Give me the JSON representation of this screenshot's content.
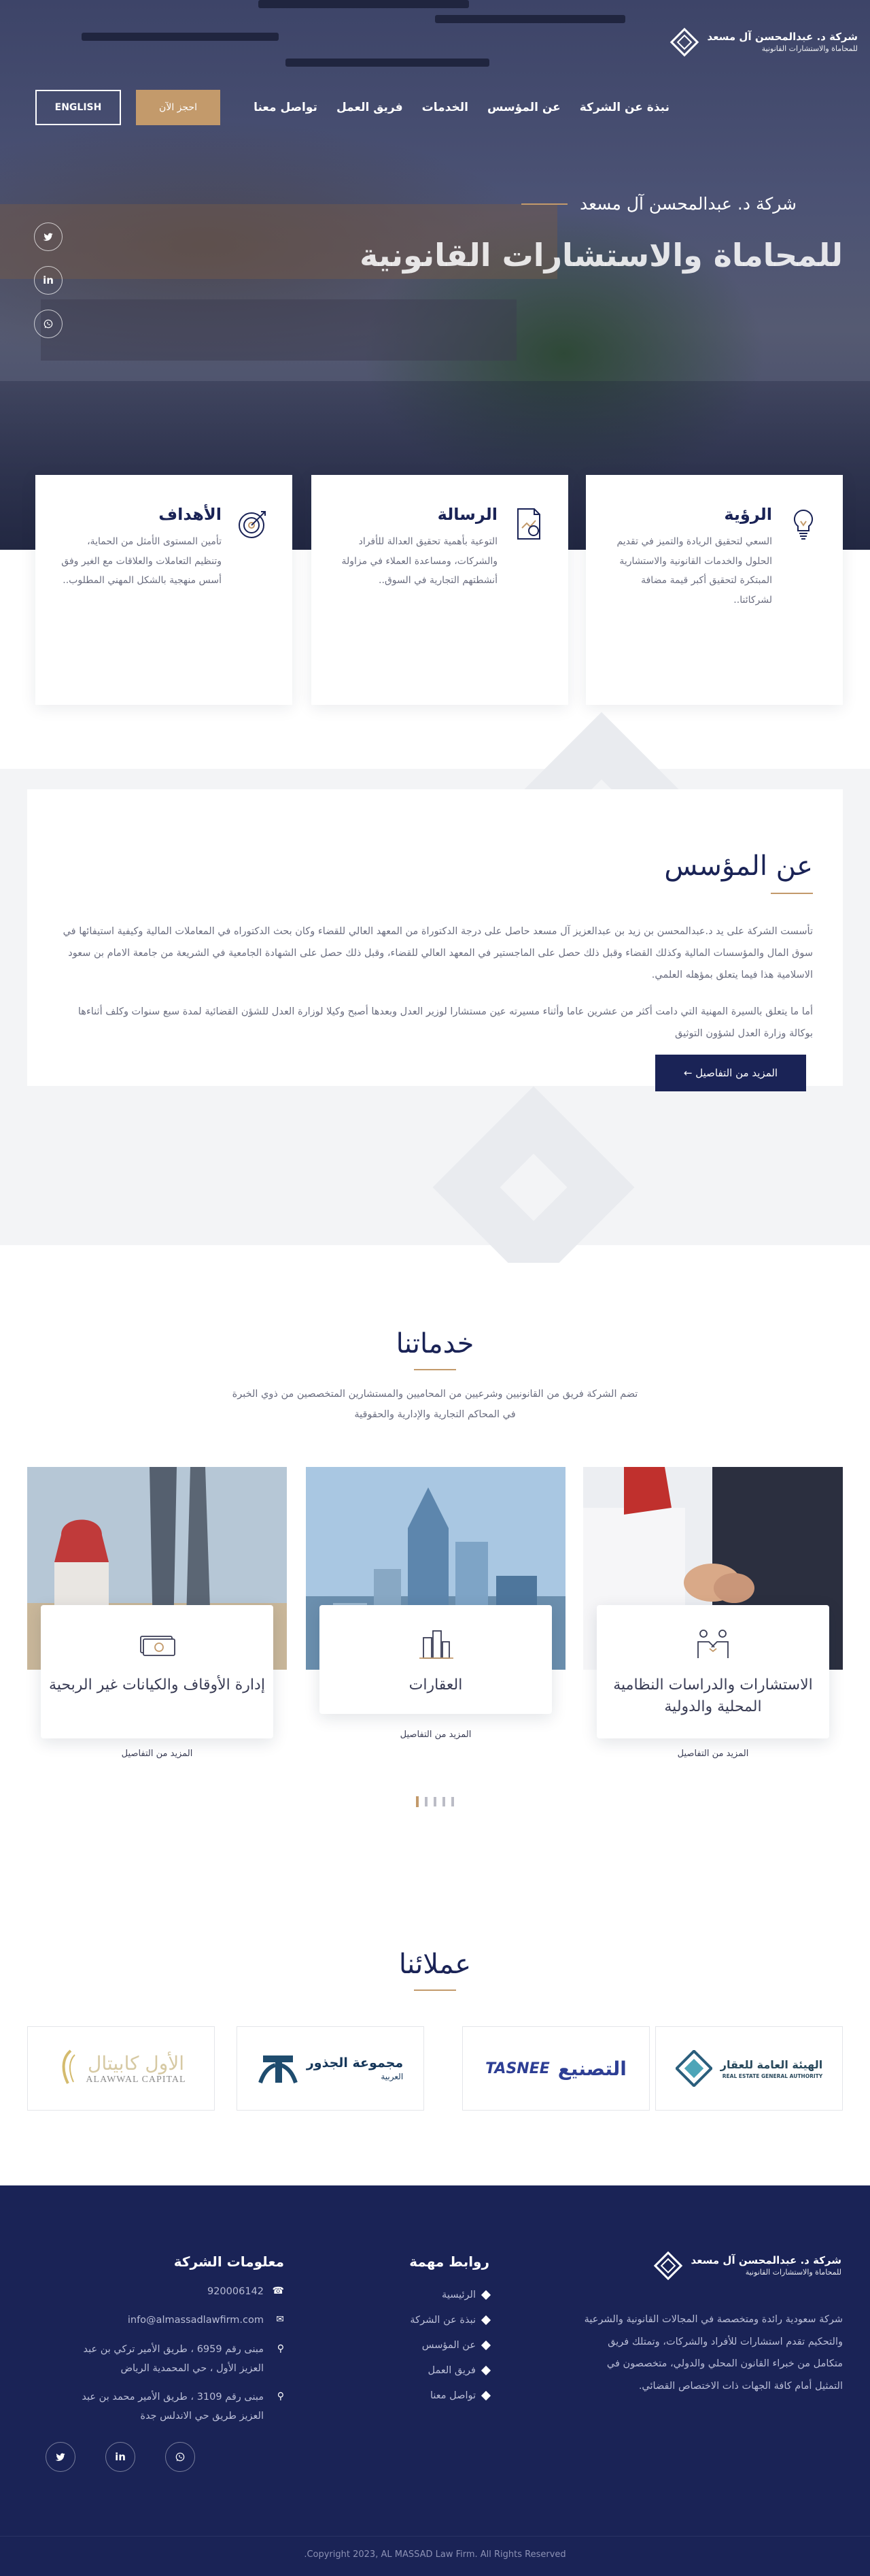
{
  "brand": {
    "name_line1": "شركة د. عبدالمحسن آل مسعد",
    "name_line2": "للمحاماة والاستشارات القانونية"
  },
  "nav": {
    "items": [
      "نبذة عن الشركة",
      "عن المؤسس",
      "الخدمات",
      "فريق العمل",
      "تواصل معنا"
    ],
    "book_label": "احجز الآن",
    "lang_label": "ENGLISH"
  },
  "hero": {
    "subtitle": "شركة د. عبدالمحسن آل مسعد",
    "title": "للمحاماة والاستشارات القانونية",
    "social": [
      "twitter-icon",
      "linkedin-icon",
      "whatsapp-icon"
    ]
  },
  "features": [
    {
      "title": "الرؤية",
      "text": "السعي لتحقيق الريادة والتميز في تقديم الحلول والخدمات القانونية والاستشارية المبتكرة لتحقيق أكبر قيمة مضافة لشركائنا..",
      "icon": "lightbulb-icon"
    },
    {
      "title": "الرسالة",
      "text": "التوعية بأهمية تحقيق العدالة للأفراد والشركات، ومساعدة العملاء في مزاولة أنشطتهم التجارية في السوق..",
      "icon": "document-chart-icon"
    },
    {
      "title": "الأهداف",
      "text": "تأمين المستوى الأمثل من الحماية، وتنظيم التعاملات والعلاقات مع الغير وفق أسس منهجية بالشكل المهني المطلوب..",
      "icon": "target-icon"
    }
  ],
  "about": {
    "title": "عن المؤسس",
    "paragraph1": "تأسست الشركة على يد د.عبدالمحسن بن زيد بن عبدالعزيز آل مسعد حاصل على درجة الدكتوراة من المعهد العالي للقضاء وكان بحث الدكتوراه في المعاملات المالية وكيفية استيفائها في سوق المال والمؤسسات المالية وكذلك القضاء وقبل ذلك حصل على الماجستير في المعهد العالي للقضاء، وقبل ذلك حصل على الشهادة الجامعية في الشريعة من جامعة الامام بن سعود الاسلامية هذا فيما يتعلق بمؤهله العلمي.",
    "paragraph2": "أما ما يتعلق بالسيرة المهنية التي دامت أكثر من عشرين عاما وأثناء مسيرته عين مستشارا لوزير العدل وبعدها أصبح وكيلا لوزارة العدل للشؤن القضائية لمدة سبع سنوات وكلف أثناءها بوكالة وزارة العدل لشؤون التوثيق",
    "more_label": "المزيد من التفاصيل ←"
  },
  "services": {
    "title": "خدماتنا",
    "intro": "تضم الشركة فريق من القانونيين وشرعيين من المحاميين والمستشارين المتخصصين من ذوي الخبرة في المحاكم التجارية والإدارية والحقوقية",
    "items": [
      {
        "title": "الاستشارات والدراسات النظامية المحلية والدولية",
        "more": "المزيد من التفاصيل",
        "icon": "handshake-icon",
        "photo": "handshake-photo"
      },
      {
        "title": "العقارات",
        "more": "المزيد من التفاصيل",
        "icon": "buildings-icon",
        "photo": "skyscrapers-photo"
      },
      {
        "title": "إدارة الأوقاف والكيانات غير الربحية",
        "more": "المزيد من التفاصيل",
        "icon": "money-icon",
        "photo": "riyadh-skyline-photo"
      }
    ]
  },
  "clients": {
    "title": "عملائنا",
    "items": [
      {
        "name": "الهيئة العامة للعقار",
        "sub": "REAL ESTATE GENERAL AUTHORITY"
      },
      {
        "name": "التصنيع",
        "sub": "TASNEE"
      },
      {
        "name": "مجموعة الجذور",
        "sub": "العربية"
      },
      {
        "name": "الأول كابيتال",
        "sub": "ALAWWAL CAPITAL"
      }
    ]
  },
  "footer": {
    "about": "شركة سعودية رائدة ومتخصصة في المجالات القانونية والشرعية والتحكيم تقدم استشارات للأفراد والشركات، وتمتلك فريق متكامل من خبراء القانون المحلي والدولي، متخصصون في التمثيل أمام كافة الجهات ذات الاختصاص القضائي.",
    "links_title": "روابط مهمة",
    "links": [
      "الرئيسية",
      "نبذة عن الشركة",
      "عن المؤسس",
      "فريق العمل",
      "تواصل معنا"
    ],
    "info_title": "معلومات الشركة",
    "phone": "920006142",
    "email": "info@almassadlawfirm.com",
    "address1": "مبنى رقم 6959 ، طريق الأمير تركي بن عبد العزيز الأول ، حي المحمدية الرياض",
    "address2": "مبنى رقم 3109 ، طريق الأمير محمد بن عبد العزيز طريق حي الاندلس جدة",
    "copyright": "Copyright 2023, AL MASSAD Law Firm. All Rights Reserved."
  },
  "colors": {
    "navy": "#1a2356",
    "gold": "#c39a6b"
  }
}
